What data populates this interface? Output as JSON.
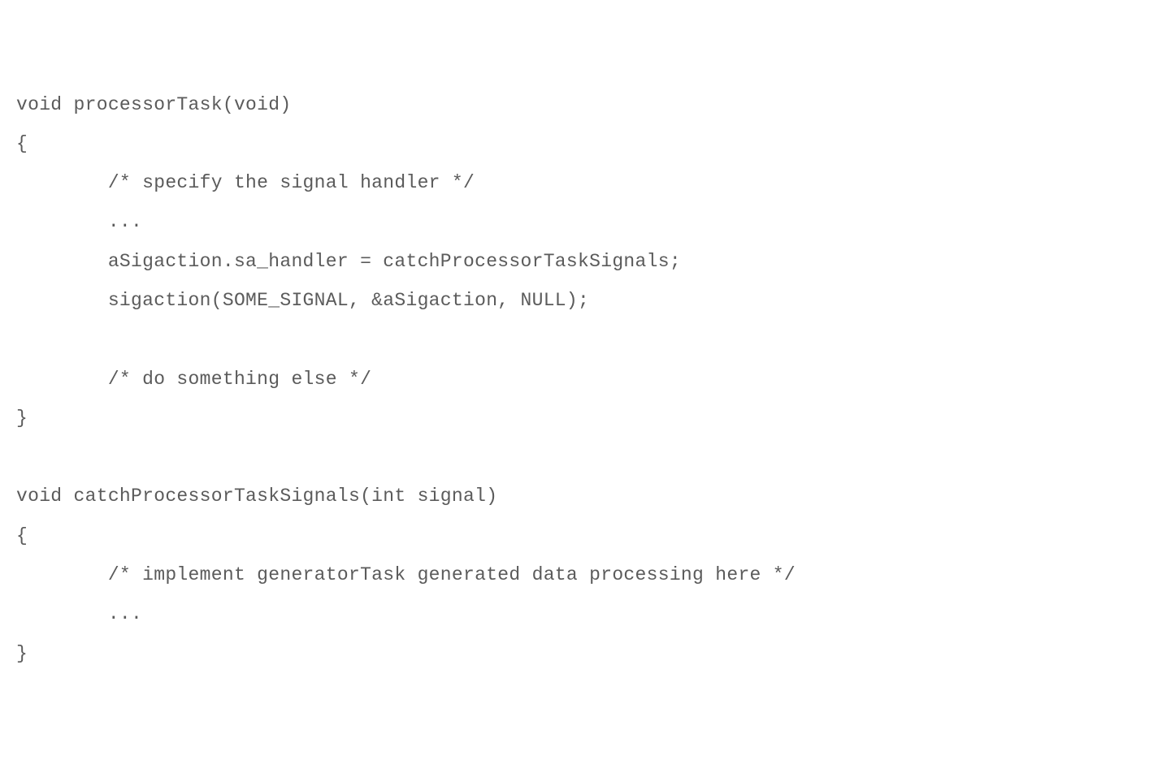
{
  "code": {
    "lines": [
      "void processorTask(void)",
      "{",
      "        /* specify the signal handler */",
      "        ...",
      "        aSigaction.sa_handler = catchProcessorTaskSignals;",
      "        sigaction(SOME_SIGNAL, &aSigaction, NULL);",
      "",
      "        /* do something else */",
      "}",
      "",
      "void catchProcessorTaskSignals(int signal)",
      "{",
      "        /* implement generatorTask generated data processing here */",
      "        ...",
      "}"
    ]
  }
}
